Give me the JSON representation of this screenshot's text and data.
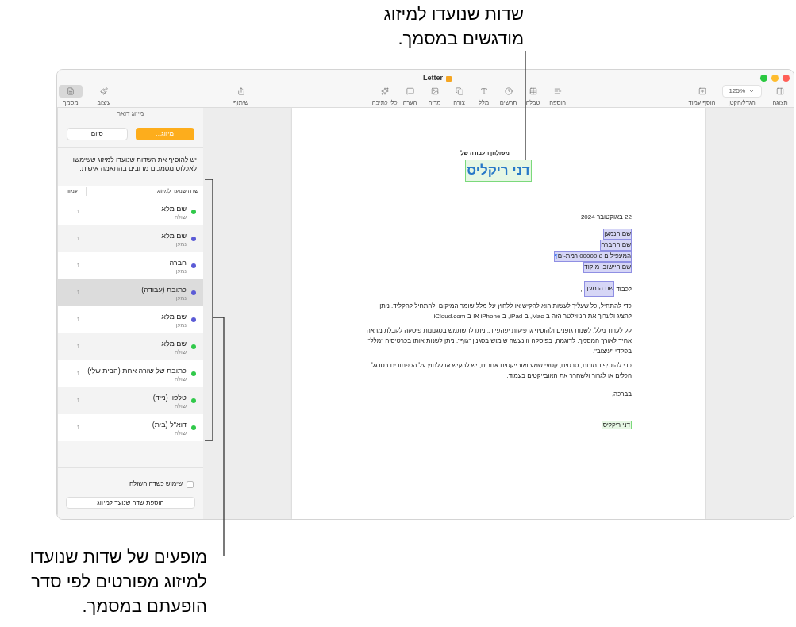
{
  "callouts": [
    {
      "lines": [
        "שדות שנועדו למיזוג",
        "מודגשים במסמך."
      ]
    },
    {
      "lines": [
        "מופעים של שדות שנועדו",
        "למיזוג מפורטים לפי סדר",
        "הופעתם במסמך."
      ]
    }
  ],
  "window": {
    "title": "Letter",
    "toolbar": {
      "right": [
        {
          "label": "תצוגה",
          "selected": false
        },
        {
          "label": "הגדל/הקטן",
          "value": "125%"
        },
        {
          "label": "הוסף עמוד",
          "selected": false
        }
      ],
      "center": [
        {
          "label": "הוספה",
          "selected": false
        },
        {
          "label": "טבלה",
          "selected": false
        },
        {
          "label": "תרשים",
          "selected": false
        },
        {
          "label": "מלל",
          "selected": false
        },
        {
          "label": "צורה",
          "selected": false
        },
        {
          "label": "מדיה",
          "selected": false
        },
        {
          "label": "הערה",
          "selected": false
        },
        {
          "label": "כלי כתיבה",
          "selected": false
        }
      ],
      "middle": [
        {
          "label": "שיתוף",
          "selected": false
        }
      ],
      "left": [
        {
          "label": "עיצוב",
          "selected": false
        },
        {
          "label": "מסמך",
          "selected": true
        }
      ]
    }
  },
  "sidebar": {
    "title": "מיזוג דואר",
    "buttons": [
      {
        "label": "מיזוג...",
        "primary": true
      },
      {
        "label": "סיום",
        "primary": false
      }
    ],
    "description": "יש להוסיף את השדות שנועדו למיזוג ששימשו לאכלוס מסמכים מרובים בהתאמה אישית.",
    "columns": [
      "שדה שנועד למיזוג",
      "עמוד"
    ],
    "rows": [
      {
        "name": "שם מלא",
        "source": "שולח",
        "page": "1",
        "color": "#30c94a",
        "selected": false
      },
      {
        "name": "שם מלא",
        "source": "נמען",
        "page": "1",
        "color": "#5b5bd6",
        "selected": false
      },
      {
        "name": "חברה",
        "source": "נמען",
        "page": "1",
        "color": "#5b5bd6",
        "selected": false
      },
      {
        "name": "כתובת (עבודה)",
        "source": "נמען",
        "page": "1",
        "color": "#5b5bd6",
        "selected": true
      },
      {
        "name": "שם מלא",
        "source": "נמען",
        "page": "1",
        "color": "#5b5bd6",
        "selected": false
      },
      {
        "name": "שם מלא",
        "source": "שולח",
        "page": "1",
        "color": "#30c94a",
        "selected": false
      },
      {
        "name": "כתובת של שורה אחת (הבית שלי)",
        "source": "שולח",
        "page": "1",
        "color": "#30c94a",
        "selected": false
      },
      {
        "name": "טלפון (נייד)",
        "source": "שולח",
        "page": "1",
        "color": "#30c94a",
        "selected": false
      },
      {
        "name": "דוא\"ל (בית)",
        "source": "שולח",
        "page": "1",
        "color": "#30c94a",
        "selected": false
      }
    ],
    "checkbox": {
      "label": "שימוש כשדה השולח",
      "checked": false
    },
    "add_button": "הוספת שדה שנועד למיזוג"
  },
  "document": {
    "subtitle": "משולחן העבודה של",
    "name_field": {
      "text": "דני ריקליס",
      "kind": "sender"
    },
    "date": "22 באוקטובר 2024",
    "address_fields": [
      {
        "text": "שם הנמען",
        "kind": "recipient"
      },
      {
        "text": "שם החברה",
        "kind": "recipient"
      },
      {
        "text": "המעפילים 8 00000 רמת-ים",
        "kind": "recipient",
        "pilcrow": "¶"
      },
      {
        "text": "שם היישוב, מיקוד",
        "kind": "recipient"
      }
    ],
    "greeting": {
      "text": "לכבוד",
      "field": {
        "text": "שם הנמען",
        "kind": "recipient"
      },
      "after": ","
    },
    "paragraphs": [
      "כדי להתחיל, כל שעליך לעשות הוא להקיש או ללחוץ על מלל שומר המיקום ולהתחיל להקליד. ניתן להציג ולערוך את הניוזלטר הזה ב-Mac, ב-iPad, ב-iPhone או ב-iCloud.com.",
      "קל לערוך מלל, לשנות גופנים ולהוסיף גרפיקות יפהפיות. ניתן להשתמש בסגנונות פיסקה לקבלת מראה אחיד לאורך המסמך. לדוגמה, בפיסקה זו נעשה שימוש בסגנון \"גוף\". ניתן לשנות אותו בכרטיסיה \"מלל\" בפקדי \"עיצוב\".",
      "כדי להוסיף תמונות, סרטים, קטעי שמע ואובייקטים אחרים, יש להקיש או ללחוץ על הכפתורים בסרגל הכלים או לגרור ולשחרר את האובייקטים בעמוד."
    ],
    "closing": "בברכה,",
    "signature_field": {
      "text": "דני ריקליס",
      "kind": "sender"
    }
  }
}
